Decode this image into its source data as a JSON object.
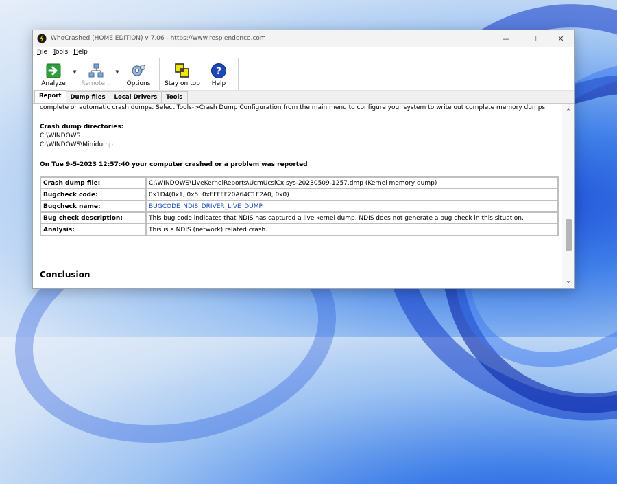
{
  "window": {
    "title": "WhoCrashed  (HOME EDITION)  v 7.06  -   https://www.resplendence.com",
    "controls": {
      "minimize": "—",
      "maximize": "☐",
      "close": "✕"
    }
  },
  "menu": [
    {
      "letter": "F",
      "rest": "ile"
    },
    {
      "letter": "T",
      "rest": "ools"
    },
    {
      "letter": "H",
      "rest": "elp"
    }
  ],
  "toolbar": {
    "analyze": "Analyze",
    "remote": "Remote ..",
    "options": "Options",
    "stay_on_top": "Stay on top",
    "help": "Help",
    "dropdown_glyph": "▼"
  },
  "tabs": [
    "Report",
    "Dump files",
    "Local Drivers",
    "Tools"
  ],
  "report": {
    "intro": "complete or automatic crash dumps. Select Tools->Crash Dump Configuration from the main menu to configure your system to write out complete memory dumps.",
    "dirs_heading": "Crash dump directories:",
    "dirs": [
      "C:\\WINDOWS",
      "C:\\WINDOWS\\Minidump"
    ],
    "crash_heading": "On Tue 9-5-2023 12:57:40 your computer crashed or a problem was reported",
    "table": [
      {
        "key": "Crash dump file:",
        "value": "C:\\WINDOWS\\LiveKernelReports\\UcmUcsiCx.sys-20230509-1257.dmp (Kernel memory dump)"
      },
      {
        "key": "Bugcheck code:",
        "value": "0x1D4(0x1, 0x5, 0xFFFFF20A64C1F2A0, 0x0)"
      },
      {
        "key": "Bugcheck name:",
        "value": "BUGCODE_NDIS_DRIVER_LIVE_DUMP"
      },
      {
        "key": "Bug check description:",
        "value": "This bug code indicates that NDIS has captured a live kernel dump. NDIS does not generate a bug check in this situation."
      },
      {
        "key": "Analysis:",
        "value": "This is a NDIS (network) related crash."
      }
    ],
    "conclusion": "Conclusion"
  },
  "scrollbar": {
    "up": "⌃",
    "down": "⌄"
  }
}
